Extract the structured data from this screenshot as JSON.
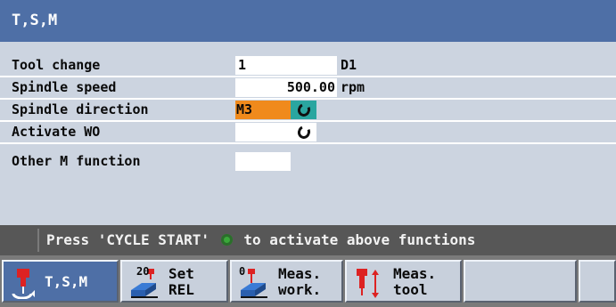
{
  "window": {
    "title": "T,S,M"
  },
  "form": {
    "tool_change": {
      "label": "Tool change",
      "value": "1",
      "suffix": "D1"
    },
    "spindle_speed": {
      "label": "Spindle speed",
      "value": "500.00",
      "unit": "rpm"
    },
    "spindle_direction": {
      "label": "Spindle direction",
      "value": "M3",
      "icon": "rotation-icon",
      "accent": "#f08a1c"
    },
    "activate_wo": {
      "label": "Activate WO",
      "value": "",
      "icon": "rotation-icon"
    },
    "other_m_function": {
      "label": "Other M function",
      "value": ""
    }
  },
  "status": {
    "message_before": "Press 'CYCLE START'",
    "message_after": "to activate above functions"
  },
  "softkeys": [
    {
      "line1": "T,S,M",
      "line2": "",
      "badge": "",
      "icon": "tool-spindle-icon"
    },
    {
      "line1": "Set",
      "line2": "REL",
      "badge": "20",
      "icon": "set-rel-icon"
    },
    {
      "line1": "Meas.",
      "line2": "work.",
      "badge": "0",
      "icon": "measure-workpiece-icon"
    },
    {
      "line1": "Meas.",
      "line2": "tool",
      "badge": "",
      "icon": "measure-tool-icon"
    },
    {
      "line1": "",
      "line2": "",
      "badge": "",
      "icon": ""
    },
    {
      "line1": "",
      "line2": "",
      "badge": "",
      "icon": ""
    }
  ],
  "colors": {
    "title_bar": "#4e6fa6",
    "background": "#ccd4e0",
    "status_bar": "#575757",
    "softkey_bar": "#7a7a7a"
  }
}
